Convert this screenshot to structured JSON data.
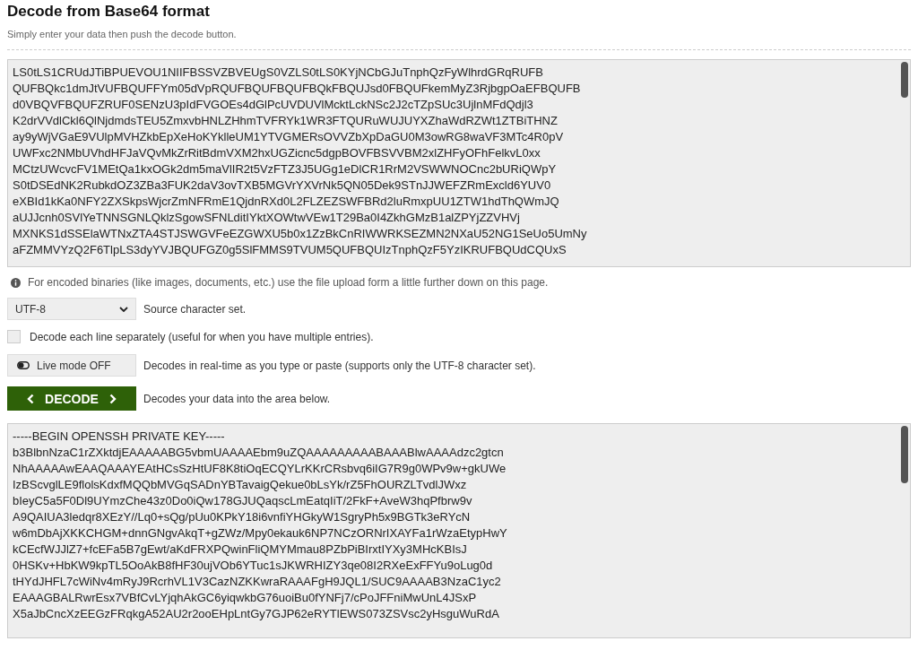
{
  "title": "Decode from Base64 format",
  "subtitle": "Simply enter your data then push the decode button.",
  "input_lines": [
    "LS0tLS1CRUdJTiBPUEVOU1NIIFBSSVZBVEUgS0VZLS0tLS0KYjNCbGJuTnphQzFyWlhrdGRqRUFB",
    "QUFBQkc1dmJtVUFBQUFFYm05dVpRQUFBQUFBQUFBQkFBQUJsd0FBQUFkemMyZ3RjbgpOaEFBQUFB",
    "d0VBQVFBQUFZRUF0SENzU3pIdFVGOEs4dGlPcUVDUVlMcktLckNSc2J2cTZpSUc3UjlnMFdQdjl3",
    "K2drVVdlCkl6QlNjdmdsTEU5ZmxvbHNLZHhmTVFRYk1WR3FTQURuWUJUYXZhaWdRZWt1ZTBiTHNZ",
    "ay9yWjVGaE9VUlpMVHZkbEpXeHoKYklleUM1YTVGMERsOVVZbXpDaGU0M3owRG8waVF3MTc4R0pV",
    "UWFxc2NMbUVhdHFJaVQvMkZrRitBdmVXM2hxUGZicnc5dgpBOVFBSVVBM2xlZHFyOFhFelkvL0xx",
    "MCtzUWcvcFV1MEtQa1kxOGk2dm5maVlIR2t5VzFTZ3J5UGg1eDlCR1RrM2VSWWNOCnc2bURiQWpY",
    "S0tDSEdNK2RubkdOZ3ZBa3FUK2daV3ovTXB5MGVrYXVrNk5QN05Dek9STnJJWEFZRmExcld6YUV0",
    "eXBId1kKa0NFY2ZXSkpsWjcrZmNFRmE1QjdnRXd0L2FLZEZSWFBRd2luRmxpUU1ZTW1hdThQWmJQ",
    "aUJJcnh0SVlYeTNNSGNLQklzSgowSFNLditIYktXOWtwVEw1T29Ba0I4ZkhGMzB1alZPYjZZVHVj",
    "MXNKS1dSSElaWTNxZTA4STJSWGVFeEZGWXU5b0x1ZzBkCnRIWWRKSEZMN2NXaU52NG1SeUo5UmNy",
    "aFZMMVYzQ2F6TlpLS3dyYVJBQUFGZ0g5SlFMMS9TVUM5QUFBQUIzTnphQzF5YzIKRUFBQUdCQUxS"
  ],
  "notice": "For encoded binaries (like images, documents, etc.) use the file upload form a little further down on this page.",
  "charset": {
    "value": "UTF-8",
    "label": "Source character set."
  },
  "each_line": {
    "label": "Decode each line separately (useful for when you have multiple entries).",
    "checked": false
  },
  "live_mode": {
    "label": "Live mode OFF",
    "on": false,
    "description": "Decodes in real-time as you type or paste (supports only the UTF-8 character set)."
  },
  "decode": {
    "label": "DECODE",
    "description": "Decodes your data into the area below."
  },
  "output_lines": [
    "-----BEGIN OPENSSH PRIVATE KEY-----",
    "b3BlbnNzaC1rZXktdjEAAAAABG5vbmUAAAAEbm9uZQAAAAAAAAABAAABlwAAAAdzc2gtcn",
    "NhAAAAAwEAAQAAAYEAtHCsSzHtUF8K8tiOqECQYLrKKrCRsbvq6iIG7R9g0WPv9w+gkUWe",
    "IzBScvglLE9flolsKdxfMQQbMVGqSADnYBTavaigQekue0bLsYk/rZ5FhOURZLTvdlJWxz",
    "bIeyC5a5F0Dl9UYmzChe43z0Do0iQw178GJUQaqscLmEatqIiT/2FkF+AveW3hqPfbrw9v",
    "A9QAIUA3ledqr8XEzY//Lq0+sQg/pUu0KPkY18i6vnfiYHGkyW1SgryPh5x9BGTk3eRYcN",
    "w6mDbAjXKKCHGM+dnnGNgvAkqT+gZWz/Mpy0ekauk6NP7NCzORNrIXAYFa1rWzaEtypHwY",
    "kCEcfWJJlZ7+fcEFa5B7gEwt/aKdFRXPQwinFliQMYMmau8PZbPiBIrxtIYXy3MHcKBIsJ",
    "0HSKv+HbKW9kpTL5OoAkB8fHF30ujVOb6YTuc1sJKWRHIZY3qe08I2RXeExFFYu9oLug0d",
    "tHYdJHFL7cWiNv4mRyJ9RcrhVL1V3CazNZKKwraRAAAFgH9JQL1/SUC9AAAAB3NzaC1yc2",
    "EAAAGBALRwrEsx7VBfCvLYjqhAkGC6yiqwkbG76uoiBu0fYNFj7/cPoJFFniMwUnL4JSxP",
    "X5aJbCncXzEEGzFRqkgA52AU2r2ooEHpLntGy7GJP62eRYTlEWS073ZSVsc2yHsguWuRdA"
  ]
}
